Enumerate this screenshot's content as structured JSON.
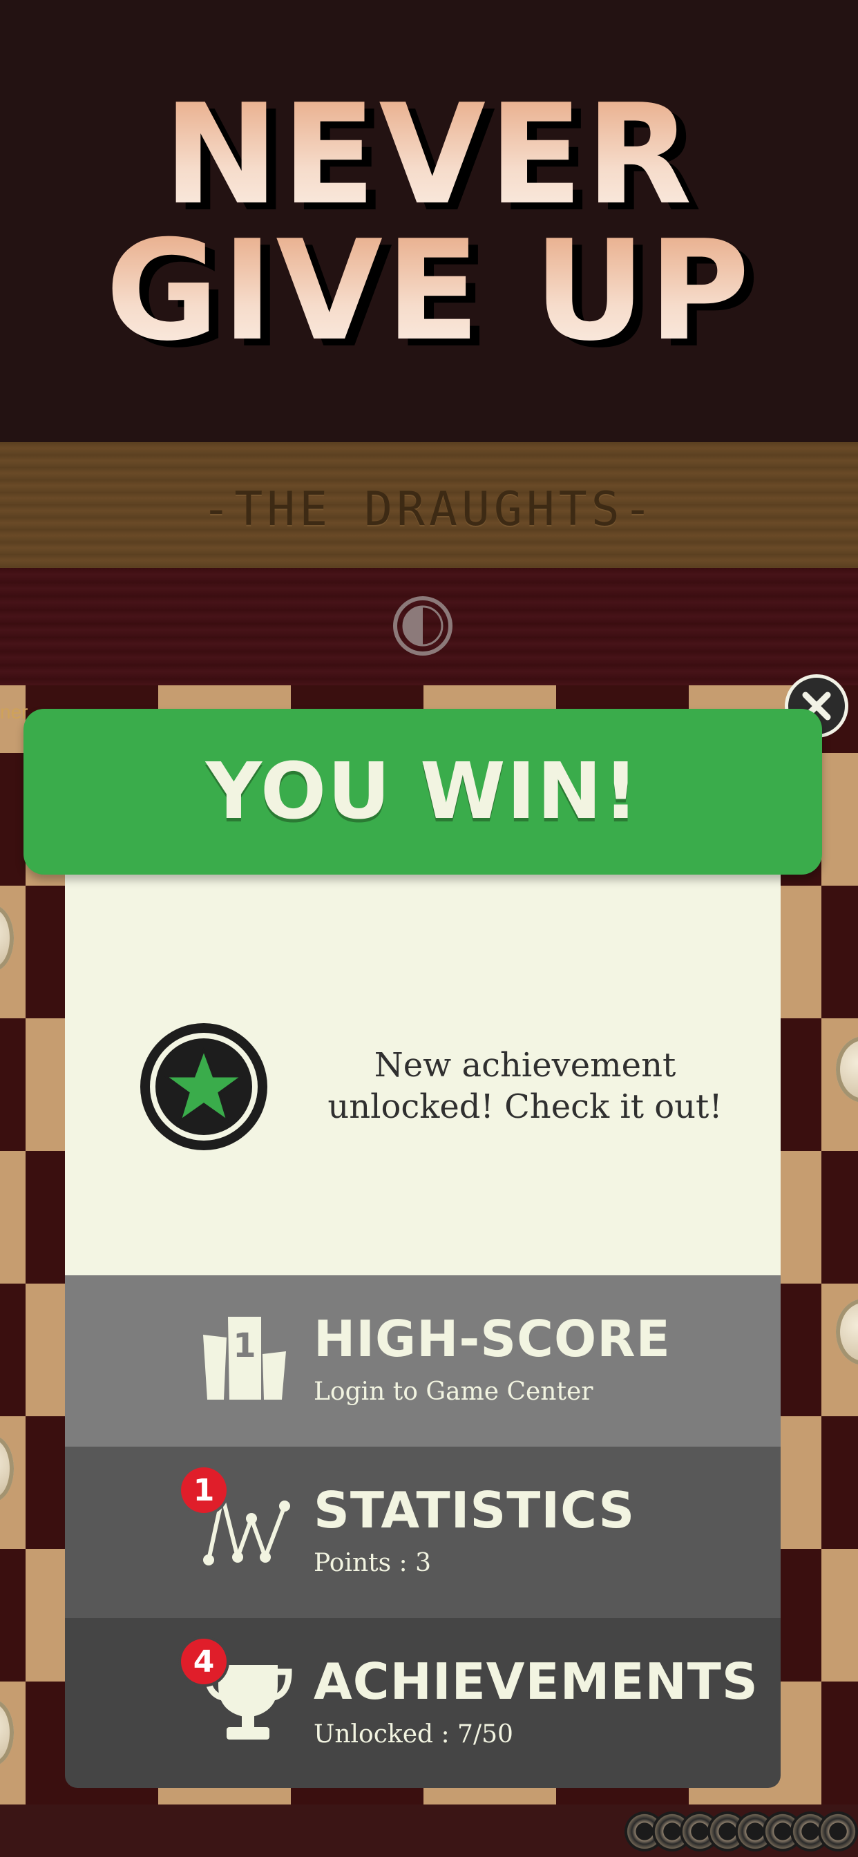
{
  "headline": {
    "line1": "NEVER",
    "line2": "GIVE UP"
  },
  "game": {
    "title": "-THE DRAUGHTS-",
    "edge_text": "ner"
  },
  "modal": {
    "banner": "YOU WIN!",
    "achievement_message": "New achievement unlocked! Check it out!",
    "rows": [
      {
        "title": "HIGH-SCORE",
        "subtitle": "Login to Game Center",
        "icon": "podium-icon"
      },
      {
        "title": "STATISTICS",
        "subtitle": "Points : 3",
        "icon": "graph-icon",
        "badge": "1"
      },
      {
        "title": "ACHIEVEMENTS",
        "subtitle": "Unlocked : 7/50",
        "icon": "trophy-icon",
        "badge": "4"
      }
    ]
  },
  "colors": {
    "banner_green": "#3aac4b",
    "panel_cream": "#f3f5e3",
    "badge_red": "#e01e2a",
    "background": "#231212"
  }
}
